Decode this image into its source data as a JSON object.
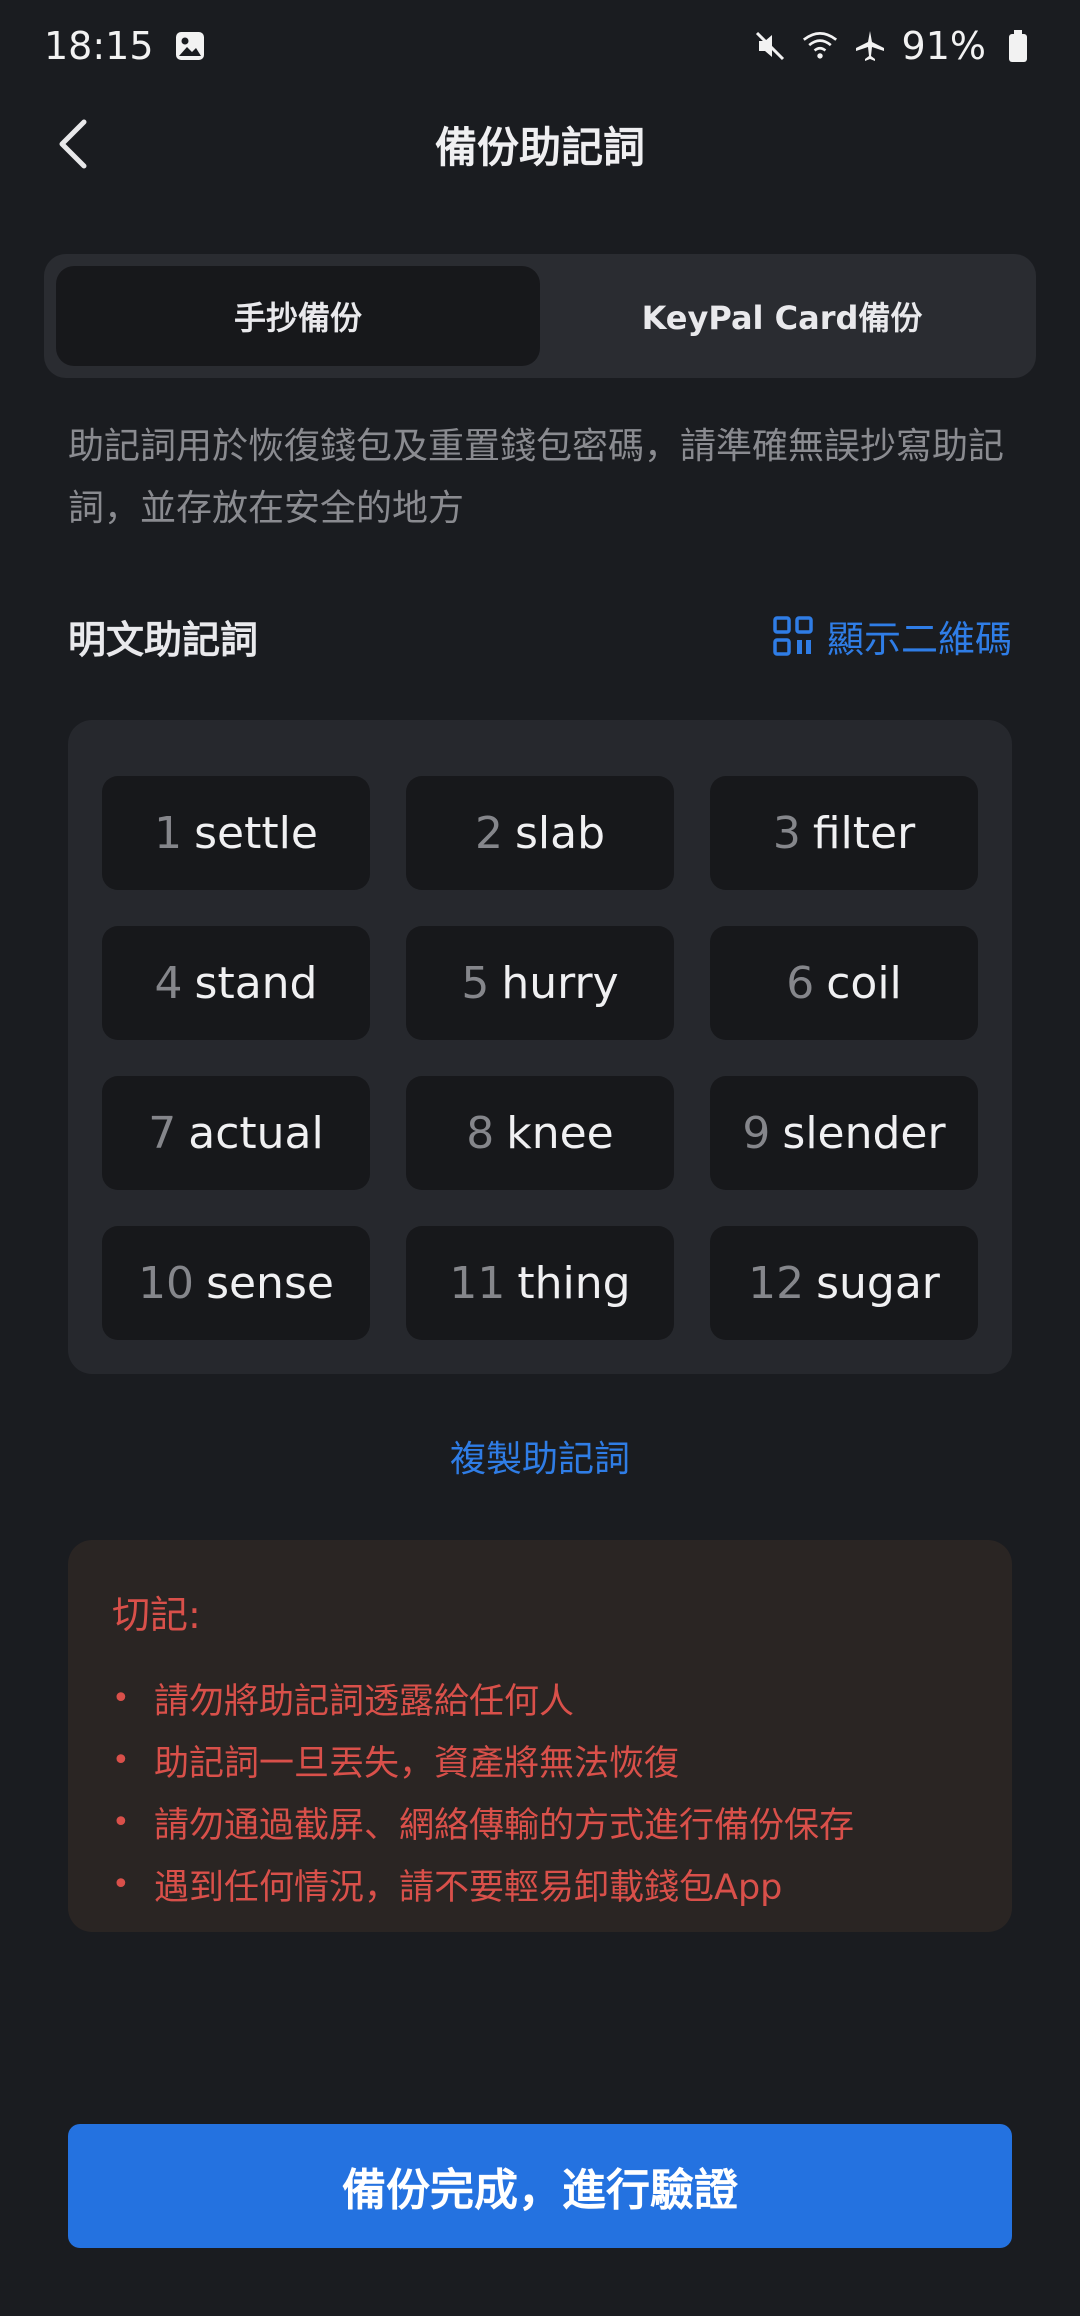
{
  "status_bar": {
    "time": "18:15",
    "battery": "91%",
    "icons": [
      "gallery-icon",
      "mute-icon",
      "wifi-icon",
      "airplane-icon",
      "battery-icon"
    ]
  },
  "header": {
    "title": "備份助記詞",
    "back_icon": "chevron-left-icon"
  },
  "tabs": [
    {
      "label": "手抄備份",
      "active": true
    },
    {
      "label": "KeyPal Card備份",
      "active": false
    }
  ],
  "description": "助記詞用於恢復錢包及重置錢包密碼，請準確無誤抄寫助記詞，並存放在安全的地方",
  "section": {
    "title": "明文助記詞",
    "qr_link": "顯示二維碼",
    "qr_icon": "qr-code-icon"
  },
  "words": [
    {
      "num": "1",
      "word": "settle"
    },
    {
      "num": "2",
      "word": "slab"
    },
    {
      "num": "3",
      "word": "filter"
    },
    {
      "num": "4",
      "word": "stand"
    },
    {
      "num": "5",
      "word": "hurry"
    },
    {
      "num": "6",
      "word": "coil"
    },
    {
      "num": "7",
      "word": "actual"
    },
    {
      "num": "8",
      "word": "knee"
    },
    {
      "num": "9",
      "word": "slender"
    },
    {
      "num": "10",
      "word": "sense"
    },
    {
      "num": "11",
      "word": "thing"
    },
    {
      "num": "12",
      "word": "sugar"
    }
  ],
  "copy_label": "複製助記詞",
  "warning": {
    "title": "切記:",
    "items": [
      "請勿將助記詞透露給任何人",
      "助記詞一旦丟失，資產將無法恢復",
      "請勿通過截屏、網絡傳輸的方式進行備份保存",
      "遇到任何情況，請不要輕易卸載錢包App"
    ]
  },
  "primary_button": "備份完成，進行驗證",
  "colors": {
    "background": "#1a1c20",
    "accent": "#2f7de6",
    "button": "#2472e0",
    "warning": "#d9504a"
  }
}
